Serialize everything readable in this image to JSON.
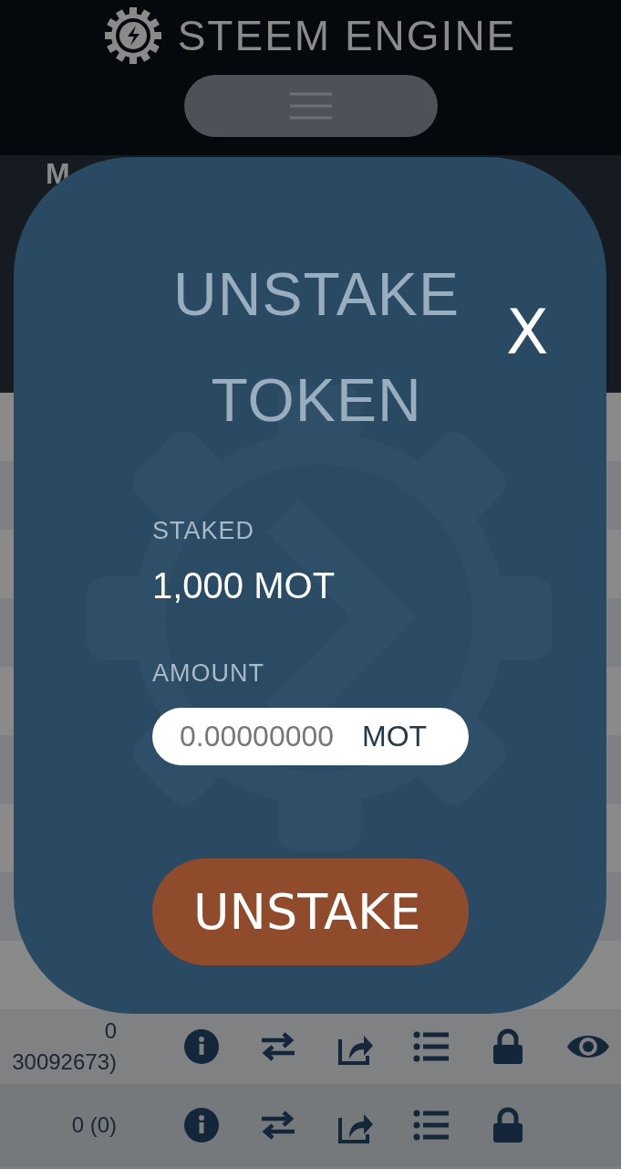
{
  "header": {
    "logo_text": "STEEM ENGINE"
  },
  "page": {
    "heading": "M"
  },
  "rows": [
    {
      "balance": [
        "0",
        "30092673)"
      ],
      "actions": [
        {
          "kind": "info"
        },
        {
          "kind": "transfer"
        },
        {
          "kind": "share"
        },
        {
          "kind": "list"
        },
        {
          "kind": "lock"
        },
        {
          "kind": "view"
        }
      ]
    },
    {
      "balance": [
        "0 (0)"
      ],
      "actions": [
        {
          "kind": "info"
        },
        {
          "kind": "transfer"
        },
        {
          "kind": "share"
        },
        {
          "kind": "list"
        },
        {
          "kind": "lock"
        }
      ]
    }
  ],
  "modal": {
    "title": "UNSTAKE TOKEN",
    "close": "X",
    "staked_label": "STAKED",
    "staked_value": "1,000 MOT",
    "amount_label": "AMOUNT",
    "amount_placeholder": "0.00000000",
    "amount_unit": "MOT",
    "submit": "UNSTAKE"
  }
}
